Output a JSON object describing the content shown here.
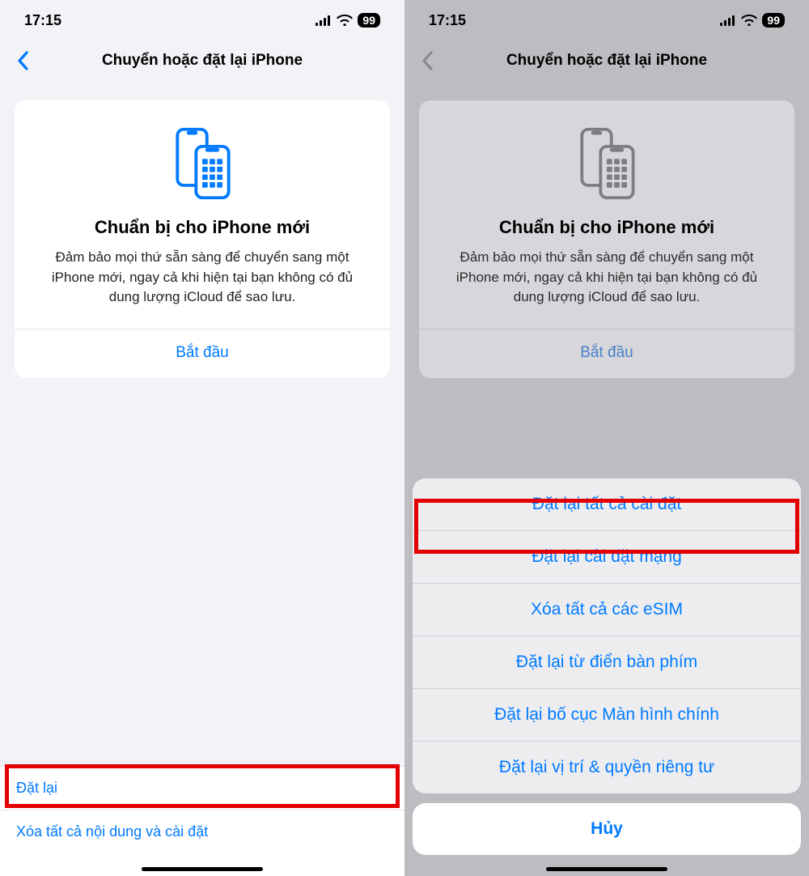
{
  "statusbar": {
    "time": "17:15",
    "battery": "99"
  },
  "nav": {
    "title": "Chuyển hoặc đặt lại iPhone"
  },
  "card": {
    "title": "Chuẩn bị cho iPhone mới",
    "desc": "Đảm bảo mọi thứ sẵn sàng để chuyển sang một iPhone mới, ngay cả khi hiện tại bạn không có đủ dung lượng iCloud để sao lưu.",
    "action": "Bắt đầu"
  },
  "left": {
    "rows": {
      "reset": "Đặt lại",
      "erase": "Xóa tất cả nội dung và cài đặt"
    }
  },
  "right": {
    "sheet": {
      "reset_all": "Đặt lại tất cả cài đặt",
      "reset_network": "Đặt lại cài đặt mạng",
      "erase_esim": "Xóa tất cả các eSIM",
      "reset_keyboard": "Đặt lại từ điển bàn phím",
      "reset_home": "Đặt lại bố cục Màn hình chính",
      "reset_privacy": "Đặt lại vị trí & quyền riêng tư"
    },
    "cancel": "Hủy"
  }
}
